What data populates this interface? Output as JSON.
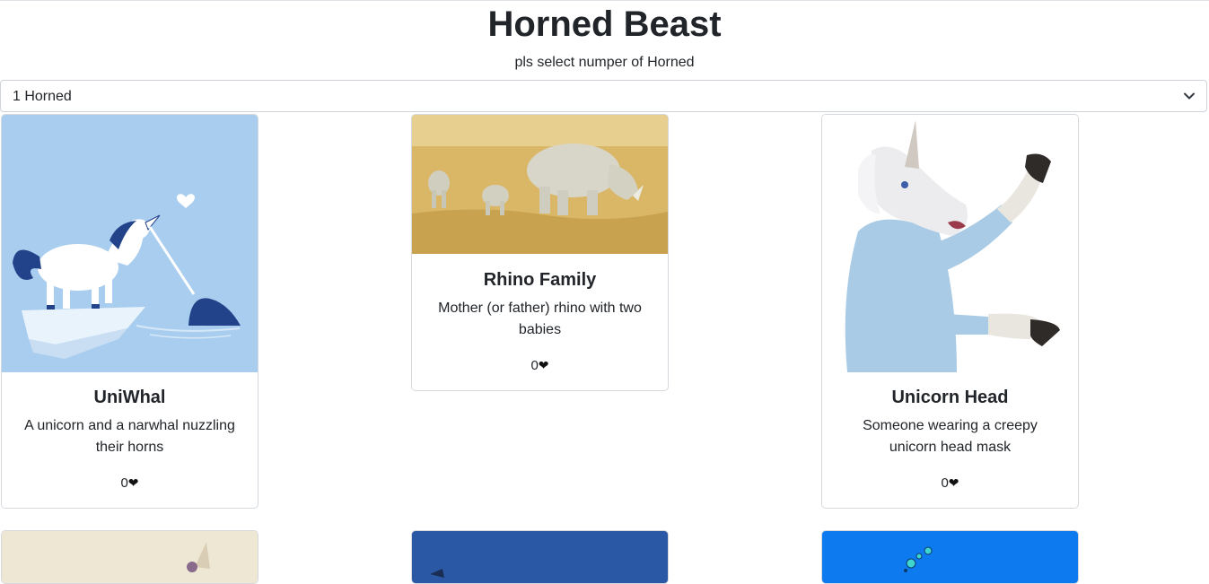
{
  "header": {
    "title": "Horned Beast",
    "subtitle": "pls select numper of Horned"
  },
  "filter": {
    "selected": "1 Horned",
    "chevron_icon": "chevron-down-icon"
  },
  "cards": [
    {
      "title": "UniWhal",
      "description": "A unicorn and a narwhal nuzzling their horns",
      "likes": "0",
      "heart_icon": "heart-icon",
      "image": "unicorn-narwhal-illustration"
    },
    {
      "title": "Rhino Family",
      "description": "Mother (or father) rhino with two babies",
      "likes": "0",
      "heart_icon": "heart-icon",
      "image": "rhino-family-photo"
    },
    {
      "title": "Unicorn Head",
      "description": "Someone wearing a creepy unicorn head mask",
      "likes": "0",
      "heart_icon": "heart-icon",
      "image": "unicorn-mask-photo"
    }
  ],
  "colors": {
    "illustration_bg": "#a9cdee",
    "navy": "#1f3f7a",
    "savanna": "#d9b766",
    "blue_card": "#2b58a4",
    "bright_blue_card": "#0d7af0"
  }
}
